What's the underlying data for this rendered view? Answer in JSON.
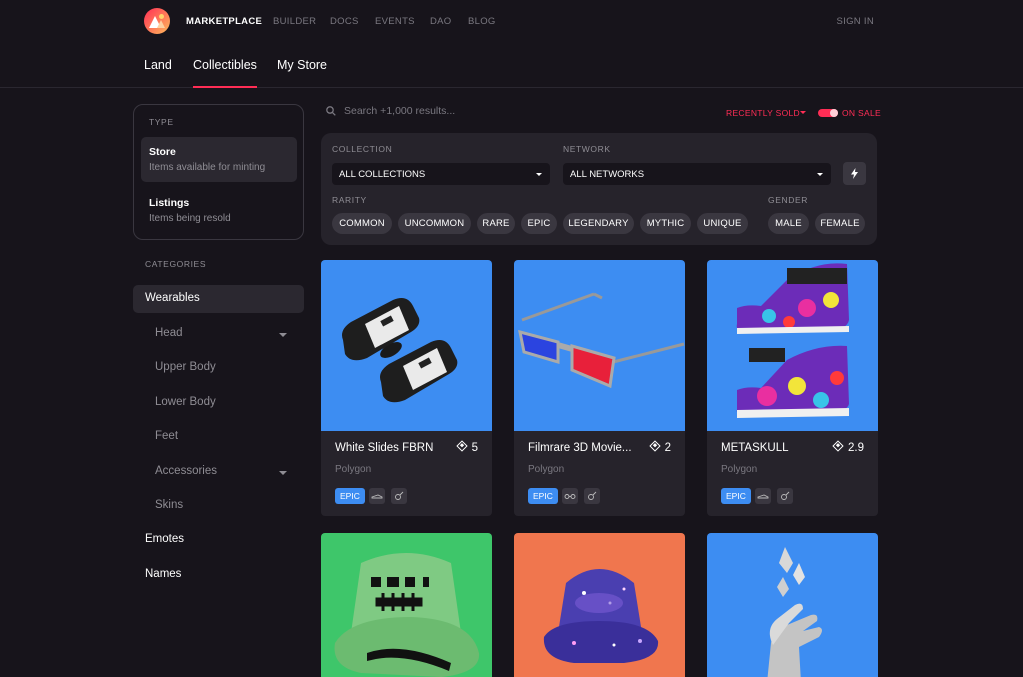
{
  "nav": {
    "links": [
      "MARKETPLACE",
      "BUILDER",
      "DOCS",
      "EVENTS",
      "DAO",
      "BLOG"
    ],
    "signin": "SIGN IN"
  },
  "subtabs": [
    "Land",
    "Collectibles",
    "My Store"
  ],
  "sidebar": {
    "type_title": "TYPE",
    "types": [
      {
        "title": "Store",
        "desc": "Items available for minting"
      },
      {
        "title": "Listings",
        "desc": "Items being resold"
      }
    ],
    "categories_title": "CATEGORIES",
    "wearables": "Wearables",
    "sub": [
      "Head",
      "Upper Body",
      "Lower Body",
      "Feet",
      "Accessories",
      "Skins"
    ],
    "emotes": "Emotes",
    "names": "Names"
  },
  "search": {
    "placeholder": "Search +1,000 results..."
  },
  "sort": {
    "label": "RECENTLY SOLD"
  },
  "onsale": {
    "label": "ON SALE",
    "enabled": true
  },
  "filters": {
    "collection_label": "COLLECTION",
    "collection_value": "ALL COLLECTIONS",
    "network_label": "NETWORK",
    "network_value": "ALL NETWORKS",
    "rarity_label": "RARITY",
    "rarity": [
      "COMMON",
      "UNCOMMON",
      "RARE",
      "EPIC",
      "LEGENDARY",
      "MYTHIC",
      "UNIQUE"
    ],
    "gender_label": "GENDER",
    "gender": [
      "MALE",
      "FEMALE"
    ]
  },
  "cards": [
    {
      "name": "White Slides FBRN",
      "price": "5",
      "network": "Polygon",
      "rarity": "EPIC",
      "bg": "#3d8df2"
    },
    {
      "name": "Filmrare 3D Movie...",
      "price": "2",
      "network": "Polygon",
      "rarity": "EPIC",
      "bg": "#3d8df2"
    },
    {
      "name": "METASKULL",
      "price": "2.9",
      "network": "Polygon",
      "rarity": "EPIC",
      "bg": "#3d8df2"
    },
    {
      "bg": "#3ec66a"
    },
    {
      "bg": "#f0764e"
    },
    {
      "bg": "#3d8df2"
    }
  ],
  "colors": {
    "accent": "#ff2d55",
    "epic": "#3d8df2"
  }
}
